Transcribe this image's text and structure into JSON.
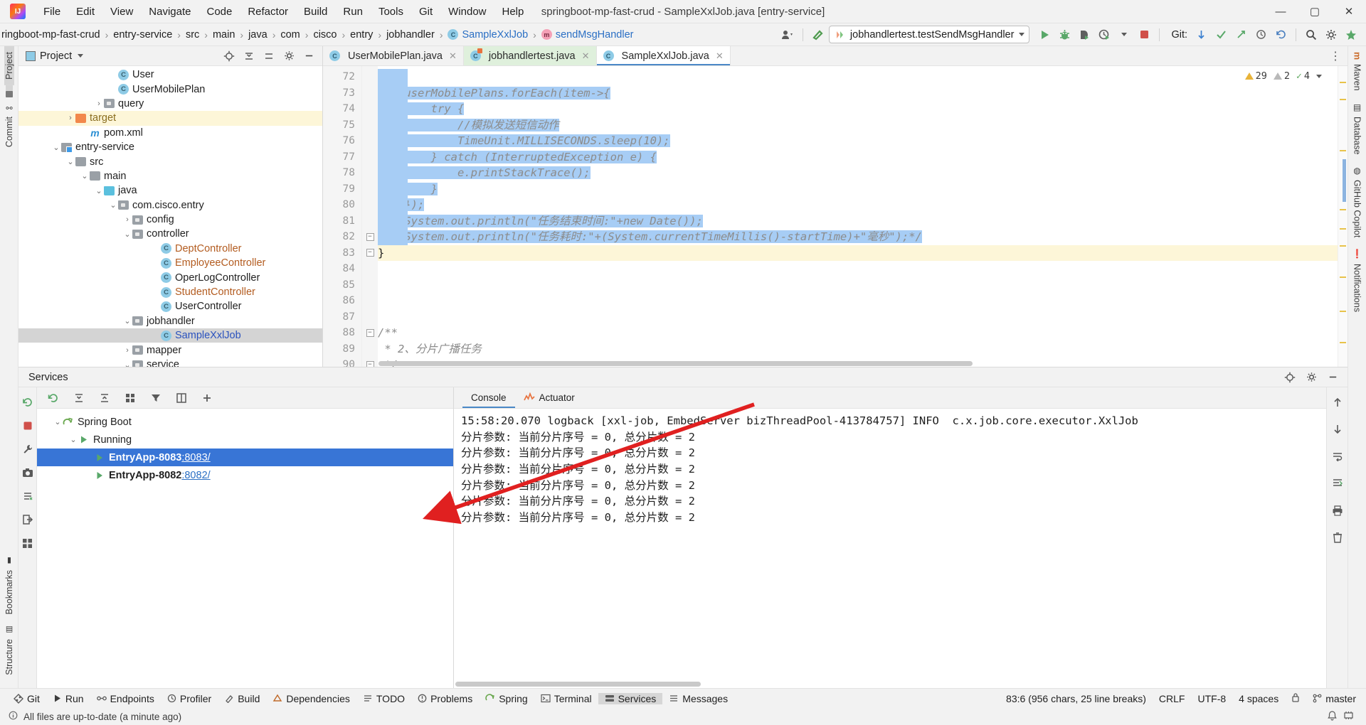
{
  "window": {
    "title": "springboot-mp-fast-crud - SampleXxlJob.java [entry-service]",
    "minimize": "—",
    "maximize": "▢",
    "close": "✕"
  },
  "menu": [
    "File",
    "Edit",
    "View",
    "Navigate",
    "Code",
    "Refactor",
    "Build",
    "Run",
    "Tools",
    "Git",
    "Window",
    "Help"
  ],
  "breadcrumbs": [
    {
      "label": "ringboot-mp-fast-crud",
      "icon": ""
    },
    {
      "label": "entry-service",
      "icon": ""
    },
    {
      "label": "src",
      "icon": ""
    },
    {
      "label": "main",
      "icon": ""
    },
    {
      "label": "java",
      "icon": ""
    },
    {
      "label": "com",
      "icon": ""
    },
    {
      "label": "cisco",
      "icon": ""
    },
    {
      "label": "entry",
      "icon": ""
    },
    {
      "label": "jobhandler",
      "icon": ""
    },
    {
      "label": "SampleXxlJob",
      "icon": "class-icon"
    },
    {
      "label": "sendMsgHandler",
      "icon": "method-icon"
    }
  ],
  "toolbar": {
    "run_config": "jobhandlertest.testSendMsgHandler",
    "run_icon": "run-icon",
    "debug_icon": "debug-icon",
    "coverage_icon": "coverage-icon",
    "profiler_icon": "profiler-icon",
    "stop_icon": "stop-icon",
    "git_label": "Git:",
    "search_icon": "search-icon",
    "settings_icon": "gear-icon",
    "updates_icon": "updates-icon",
    "user_icon": "user-icon",
    "hammer_icon": "build-hammer-icon"
  },
  "left_tool_buttons": [
    "Project",
    "Commit",
    "Bookmarks",
    "Structure"
  ],
  "right_tool_buttons": [
    "Maven",
    "Database",
    "GitHub Copilot",
    "Notifications"
  ],
  "project_panel": {
    "title": "Project",
    "locate_icon": "locate-icon",
    "collapse_icon": "collapse-all-icon",
    "expand_icon": "expand-icon",
    "settings_icon": "gear-icon",
    "hide_icon": "hide-icon",
    "tree": [
      {
        "indent": 7,
        "arrow": "",
        "icon": "class",
        "label": "User",
        "color": "plain"
      },
      {
        "indent": 7,
        "arrow": "",
        "icon": "class",
        "label": "UserMobilePlan",
        "color": "plain"
      },
      {
        "indent": 6,
        "arrow": "›",
        "icon": "pkg",
        "label": "query",
        "color": "plain"
      },
      {
        "indent": 4,
        "arrow": "›",
        "icon": "orange",
        "label": "target",
        "color": "brown",
        "row": "sel-yellow"
      },
      {
        "indent": 5,
        "arrow": "",
        "icon": "maven",
        "label": "pom.xml",
        "color": "plain"
      },
      {
        "indent": 3,
        "arrow": "⌄",
        "icon": "module",
        "label": "entry-service",
        "color": "plain"
      },
      {
        "indent": 4,
        "arrow": "⌄",
        "icon": "gray",
        "label": "src",
        "color": "plain"
      },
      {
        "indent": 5,
        "arrow": "⌄",
        "icon": "gray",
        "label": "main",
        "color": "plain"
      },
      {
        "indent": 6,
        "arrow": "⌄",
        "icon": "blue",
        "label": "java",
        "color": "plain"
      },
      {
        "indent": 7,
        "arrow": "⌄",
        "icon": "pkg",
        "label": "com.cisco.entry",
        "color": "plain"
      },
      {
        "indent": 8,
        "arrow": "›",
        "icon": "pkg",
        "label": "config",
        "color": "plain"
      },
      {
        "indent": 8,
        "arrow": "⌄",
        "icon": "pkg",
        "label": "controller",
        "color": "plain"
      },
      {
        "indent": 10,
        "arrow": "",
        "icon": "class",
        "label": "DeptController",
        "color": "orange"
      },
      {
        "indent": 10,
        "arrow": "",
        "icon": "class",
        "label": "EmployeeController",
        "color": "orange"
      },
      {
        "indent": 10,
        "arrow": "",
        "icon": "class",
        "label": "OperLogController",
        "color": "plain"
      },
      {
        "indent": 10,
        "arrow": "",
        "icon": "class",
        "label": "StudentController",
        "color": "orange"
      },
      {
        "indent": 10,
        "arrow": "",
        "icon": "class",
        "label": "UserController",
        "color": "plain"
      },
      {
        "indent": 8,
        "arrow": "⌄",
        "icon": "pkg",
        "label": "jobhandler",
        "color": "plain"
      },
      {
        "indent": 10,
        "arrow": "",
        "icon": "class",
        "label": "SampleXxlJob",
        "color": "blue",
        "row": "sel-gray"
      },
      {
        "indent": 8,
        "arrow": "›",
        "icon": "pkg",
        "label": "mapper",
        "color": "plain"
      },
      {
        "indent": 8,
        "arrow": "⌄",
        "icon": "pkg",
        "label": "service",
        "color": "plain"
      }
    ]
  },
  "editor": {
    "tabs": [
      {
        "label": "UserMobilePlan.java",
        "icon": "class-icon",
        "style": "plain"
      },
      {
        "label": "jobhandlertest.java",
        "icon": "test-class-icon",
        "style": "green"
      },
      {
        "label": "SampleXxlJob.java",
        "icon": "class-icon",
        "style": "active"
      }
    ],
    "more_icon": "more-options-icon",
    "inspections": {
      "warnings": "29",
      "weak_warnings": "2",
      "typos": "4",
      "chevron": "⌄"
    },
    "lines": [
      {
        "no": "72",
        "text": "",
        "sel": true
      },
      {
        "no": "73",
        "text": "    userMobilePlans.forEach(item->{",
        "sel": true
      },
      {
        "no": "74",
        "text": "        try {",
        "sel": true
      },
      {
        "no": "75",
        "text": "            //模拟发送短信动作",
        "sel": true
      },
      {
        "no": "76",
        "text": "            TimeUnit.MILLISECONDS.sleep(10);",
        "sel": true
      },
      {
        "no": "77",
        "text": "        } catch (InterruptedException e) {",
        "sel": true
      },
      {
        "no": "78",
        "text": "            e.printStackTrace();",
        "sel": true
      },
      {
        "no": "79",
        "text": "        }",
        "sel": true
      },
      {
        "no": "80",
        "text": "    });",
        "sel": true
      },
      {
        "no": "81",
        "text": "    System.out.println(\"任务结束时间:\"+new Date());",
        "sel": true
      },
      {
        "no": "82",
        "text": "    System.out.println(\"任务耗时:\"+(System.currentTimeMillis()-startTime)+\"毫秒\");*/",
        "sel": true
      },
      {
        "no": "83",
        "text": "}",
        "sel": false,
        "highlight": true
      },
      {
        "no": "84",
        "text": "",
        "sel": false
      },
      {
        "no": "85",
        "text": "",
        "sel": false
      },
      {
        "no": "86",
        "text": "",
        "sel": false
      },
      {
        "no": "87",
        "text": "",
        "sel": false
      },
      {
        "no": "88",
        "text": "/**",
        "sel": false
      },
      {
        "no": "89",
        "text": " * 2、分片广播任务",
        "sel": false
      },
      {
        "no": "90",
        "text": " */",
        "sel": false
      }
    ]
  },
  "services": {
    "title": "Services",
    "toolbar_icons": [
      "refresh-icon",
      "expand-all-icon",
      "collapse-all-icon",
      "group-icon",
      "filter-icon",
      "layout-icon",
      "add-icon"
    ],
    "action_icons": [
      "rerun-icon",
      "stop-icon",
      "wrench-icon",
      "camera-icon",
      "thread-dump-icon",
      "exit-icon",
      "grid-icon"
    ],
    "header_icons": [
      "locate-icon",
      "gear-icon",
      "hide-icon"
    ],
    "tree": [
      {
        "indent": 1,
        "arrow": "⌄",
        "icon": "spring",
        "label": "Spring Boot",
        "sel": false
      },
      {
        "indent": 2,
        "arrow": "⌄",
        "icon": "run",
        "label": "Running",
        "sel": false
      },
      {
        "indent": 3,
        "arrow": "",
        "icon": "leaf",
        "label": "EntryApp-8083",
        "port": ":8083/",
        "sel": true
      },
      {
        "indent": 3,
        "arrow": "",
        "icon": "leaf",
        "label": "EntryApp-8082",
        "port": ":8082/",
        "sel": false
      }
    ],
    "console_tabs": [
      {
        "label": "Console",
        "active": true,
        "icon": ""
      },
      {
        "label": "Actuator",
        "active": false,
        "icon": "actuator-icon"
      }
    ],
    "console_lines": [
      "15:58:20.070 logback [xxl-job, EmbedServer bizThreadPool-413784757] INFO  c.x.job.core.executor.XxlJob",
      "分片参数: 当前分片序号 = 0, 总分片数 = 2",
      "分片参数: 当前分片序号 = 0, 总分片数 = 2",
      "分片参数: 当前分片序号 = 0, 总分片数 = 2",
      "分片参数: 当前分片序号 = 0, 总分片数 = 2",
      "分片参数: 当前分片序号 = 0, 总分片数 = 2",
      "分片参数: 当前分片序号 = 0, 总分片数 = 2"
    ],
    "console_side_icons": [
      "scroll-up-icon",
      "scroll-down-icon",
      "soft-wrap-icon",
      "scroll-end-icon",
      "print-icon",
      "clear-all-icon"
    ]
  },
  "statusbar": {
    "items": [
      {
        "label": "Git",
        "icon": "git-icon",
        "active": false
      },
      {
        "label": "Run",
        "icon": "run-icon",
        "active": false
      },
      {
        "label": "Endpoints",
        "icon": "endpoints-icon",
        "active": false
      },
      {
        "label": "Profiler",
        "icon": "profiler-icon",
        "active": false
      },
      {
        "label": "Build",
        "icon": "build-icon",
        "active": false
      },
      {
        "label": "Dependencies",
        "icon": "dependencies-icon",
        "active": false
      },
      {
        "label": "TODO",
        "icon": "todo-icon",
        "active": false
      },
      {
        "label": "Problems",
        "icon": "problems-icon",
        "active": false
      },
      {
        "label": "Spring",
        "icon": "spring-icon",
        "active": false
      },
      {
        "label": "Terminal",
        "icon": "terminal-icon",
        "active": false
      },
      {
        "label": "Services",
        "icon": "services-icon",
        "active": true
      },
      {
        "label": "Messages",
        "icon": "messages-icon",
        "active": false
      }
    ],
    "message": "All files are up-to-date (a minute ago)",
    "caret": "83:6 (956 chars, 25 line breaks)",
    "line_sep": "CRLF",
    "encoding": "UTF-8",
    "indent": "4 spaces",
    "branch": "master",
    "lock_icon": "lock-icon",
    "notification_icon": "notification-icon"
  },
  "colors": {
    "accent": "#3875d6",
    "selection": "#a7cdf5",
    "green": "#59a869",
    "orange": "#b35c20",
    "warning": "#e8b339",
    "annotation_red": "#e02020"
  }
}
